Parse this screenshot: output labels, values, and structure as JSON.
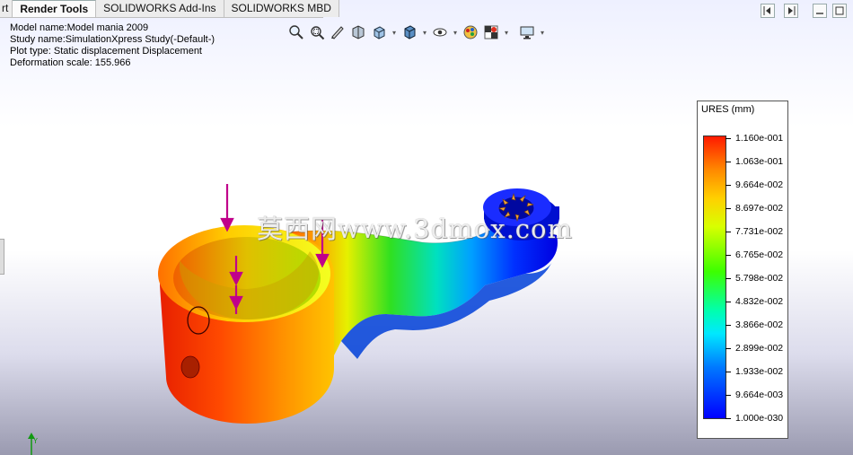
{
  "tabs": [
    {
      "label": "rt",
      "active": false
    },
    {
      "label": "Render Tools",
      "active": true
    },
    {
      "label": "SOLIDWORKS Add-Ins",
      "active": false
    },
    {
      "label": "SOLIDWORKS MBD",
      "active": false
    }
  ],
  "info": {
    "model_name": "Model name:Model mania 2009",
    "study_name": "Study name:SimulationXpress Study(-Default-)",
    "plot_type": "Plot type: Static displacement Displacement",
    "deformation_scale": "Deformation scale: 155.966"
  },
  "view_toolbar": {
    "icons": [
      "zoom-to-fit-icon",
      "zoom-to-area-icon",
      "previous-view-icon",
      "section-view-icon",
      "view-orientation-icon",
      "display-style-icon",
      "hide-show-items-icon",
      "edit-appearance-icon",
      "apply-scene-icon",
      "view-settings-icon"
    ]
  },
  "legend": {
    "title": "URES (mm)",
    "labels": [
      "1.160e-001",
      "1.063e-001",
      "9.664e-002",
      "8.697e-002",
      "7.731e-002",
      "6.765e-002",
      "5.798e-002",
      "4.832e-002",
      "3.866e-002",
      "2.899e-002",
      "1.933e-002",
      "9.664e-003",
      "1.000e-030"
    ]
  },
  "watermark": "莫西网www.3dmox.com",
  "colors": {
    "max": "#ff1a00",
    "min": "#0000ff",
    "load_arrow": "#c0008a"
  }
}
